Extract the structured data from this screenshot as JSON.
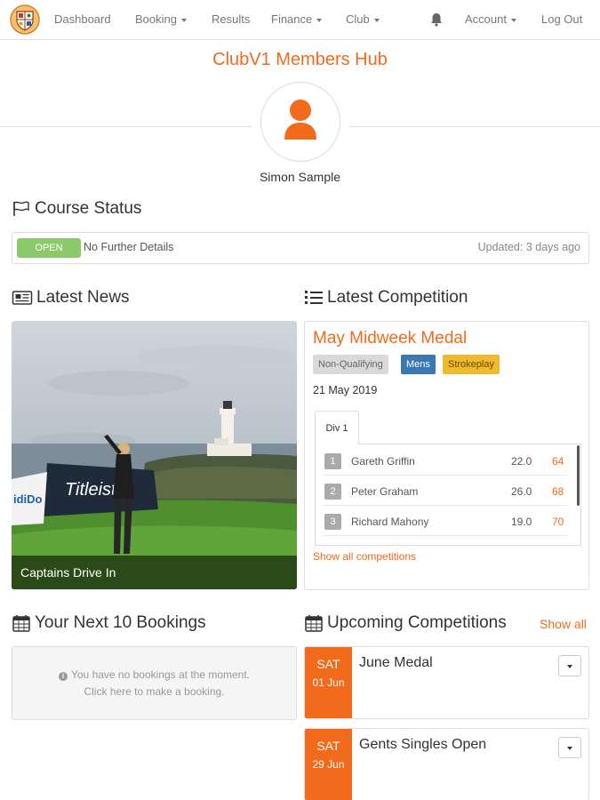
{
  "nav": {
    "logo_icon": "club-crest-icon",
    "items": [
      {
        "label": "Dashboard",
        "dropdown": false
      },
      {
        "label": "Booking",
        "dropdown": true
      },
      {
        "label": "Results",
        "dropdown": false
      },
      {
        "label": "Finance",
        "dropdown": true
      },
      {
        "label": "Club",
        "dropdown": true
      }
    ],
    "notifications_icon": "bell-icon",
    "account_label": "Account",
    "logout_label": "Log Out"
  },
  "header": {
    "title": "ClubV1 Members Hub",
    "avatar_icon": "user-icon",
    "member_name": "Simon Sample"
  },
  "course_status": {
    "heading": "Course Status",
    "heading_icon": "flag-icon",
    "status": "OPEN",
    "details": "No Further Details",
    "updated": "Updated: 3 days ago"
  },
  "news": {
    "heading": "Latest News",
    "heading_icon": "newspaper-icon",
    "caption": "Captains Drive In"
  },
  "latest_competition": {
    "heading": "Latest Competition",
    "heading_icon": "list-ol-icon",
    "title": "May Midweek Medal",
    "tags": [
      "Non-Qualifying",
      "Mens",
      "Strokeplay"
    ],
    "date": "21 May 2019",
    "tab": "Div 1",
    "results": [
      {
        "rank": "1",
        "name": "Gareth Griffin",
        "handicap": "22.0",
        "score": "64"
      },
      {
        "rank": "2",
        "name": "Peter Graham",
        "handicap": "26.0",
        "score": "68"
      },
      {
        "rank": "3",
        "name": "Richard Mahony",
        "handicap": "19.0",
        "score": "70"
      }
    ],
    "show_all_label": "Show all competitions"
  },
  "bookings": {
    "heading": "Your Next 10 Bookings",
    "heading_icon": "calendar-icon",
    "empty_line1": "You have no bookings at the moment.",
    "empty_line2": "Click here to make a booking."
  },
  "upcoming": {
    "heading": "Upcoming Competitions",
    "heading_icon": "calendar-icon",
    "show_all_label": "Show all",
    "items": [
      {
        "day": "SAT",
        "date": "01 Jun",
        "name": "June Medal"
      },
      {
        "day": "SAT",
        "date": "29 Jun",
        "name": "Gents Singles Open"
      }
    ]
  },
  "colors": {
    "brand": "#f26b1d",
    "open": "#8cc96a",
    "tag_grey": "#d9d9d9",
    "tag_blue": "#3a78b4",
    "tag_yellow": "#f0ba2e"
  }
}
